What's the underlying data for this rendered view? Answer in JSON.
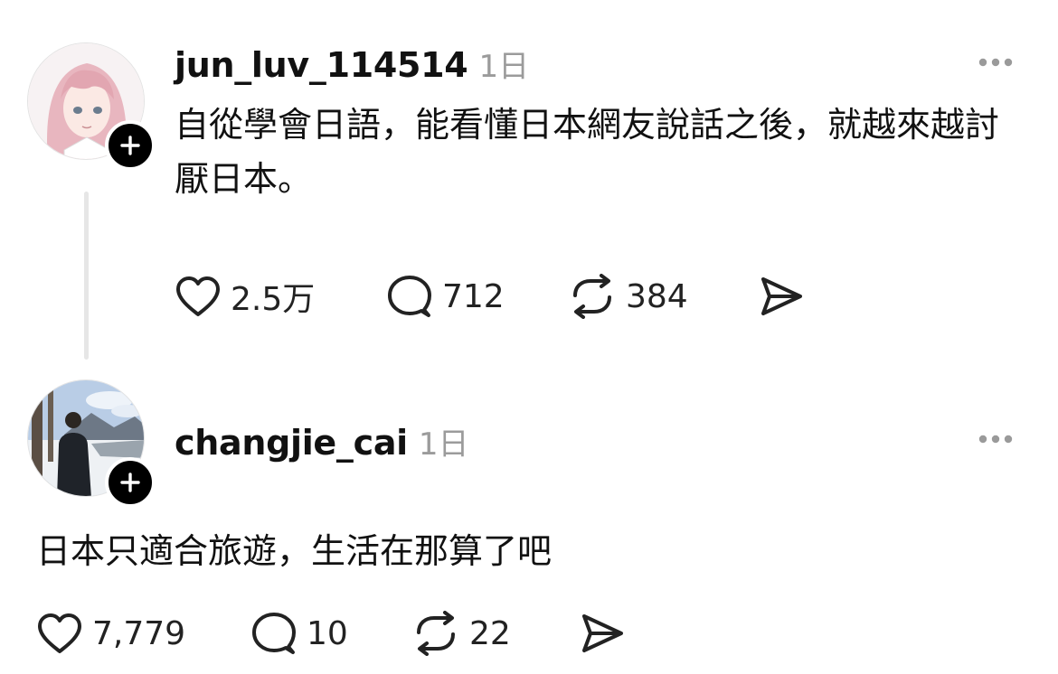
{
  "posts": [
    {
      "username": "jun_luv_114514",
      "time": "1日",
      "text": "自從學會日語，能看懂日本網友說話之後，就越來越討厭日本。",
      "actions": {
        "likes": "2.5万",
        "replies": "712",
        "reposts": "384"
      },
      "avatar_icon": "anime-girl-avatar"
    },
    {
      "username": "changjie_cai",
      "time": "1日",
      "text": "日本只適合旅遊，生活在那算了吧",
      "actions": {
        "likes": "7,779",
        "replies": "10",
        "reposts": "22"
      },
      "avatar_icon": "snowy-landscape-avatar"
    }
  ],
  "icons": {
    "like": "heart-icon",
    "reply": "comment-icon",
    "repost": "repost-icon",
    "share": "send-icon",
    "more": "more-icon",
    "follow": "plus-icon"
  },
  "colors": {
    "text": "#111111",
    "muted": "#9b9b9b",
    "thread_line": "#e6e6e6",
    "badge": "#000000"
  }
}
